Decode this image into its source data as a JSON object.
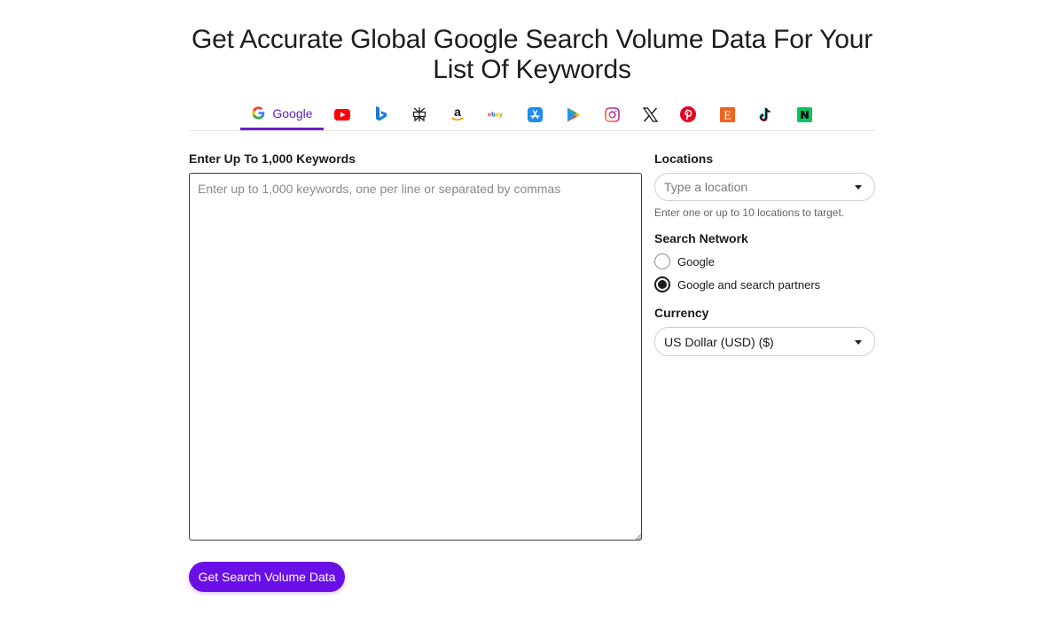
{
  "page": {
    "title_line1": "Get Accurate Global Google Search Volume Data For Your",
    "title_line2": "List Of Keywords"
  },
  "tabs": {
    "active_label": "Google",
    "items": [
      "google-icon",
      "youtube-icon",
      "bing-icon",
      "perplexity-icon",
      "amazon-icon",
      "ebay-icon",
      "app-store-icon",
      "google-play-icon",
      "instagram-icon",
      "x-icon",
      "pinterest-icon",
      "etsy-icon",
      "tiktok-icon",
      "naver-icon"
    ]
  },
  "keywords": {
    "label": "Enter Up To 1,000 Keywords",
    "placeholder": "Enter up to 1,000 keywords, one per line or separated by commas"
  },
  "locations": {
    "label": "Locations",
    "placeholder": "Type a location",
    "help": "Enter one or up to 10 locations to target."
  },
  "network": {
    "label": "Search Network",
    "options": [
      "Google",
      "Google and search partners"
    ],
    "selected": "Google and search partners"
  },
  "currency": {
    "label": "Currency",
    "value": "US Dollar (USD) ($)"
  },
  "cta": {
    "label": "Get Search Volume Data"
  },
  "colors": {
    "accent": "#6a0fe8",
    "tab_active": "#6a1fd0"
  }
}
